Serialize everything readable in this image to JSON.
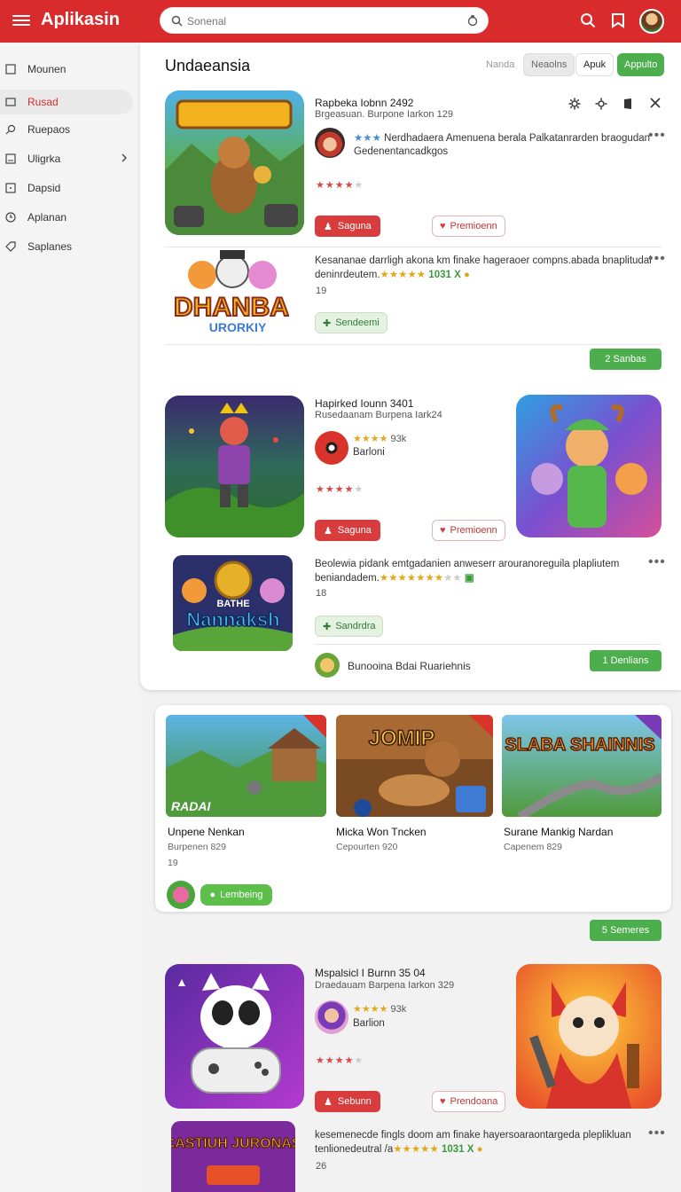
{
  "app": {
    "title": "Aplikasin"
  },
  "search": {
    "placeholder": "Sonenal"
  },
  "sidebar": {
    "items": [
      {
        "label": "Mounen",
        "icon": "page-icon"
      },
      {
        "label": "Rusad",
        "icon": "page-icon"
      },
      {
        "label": "Ruepaos",
        "icon": "search-icon"
      },
      {
        "label": "Uligrka",
        "icon": "page-icon"
      },
      {
        "label": "Dapsid",
        "icon": "page-icon"
      },
      {
        "label": "Aplanan",
        "icon": "clock-icon"
      },
      {
        "label": "Saplanes",
        "icon": "tag-icon"
      }
    ]
  },
  "section": {
    "title": "Undaeansia"
  },
  "filters": [
    "Nanda",
    "Neaolns",
    "Apuk",
    "Appulto"
  ],
  "row1": {
    "title": "Rapbeka  Iobnn  2492",
    "sub": "Brgeasuan.  Burpone  Iarkon  129",
    "desc_line1": "Nerdhadaera  Amenuena  berala  Palkatanrarden  braogudan",
    "desc_line2": "Gedenentancadkgos",
    "rating": 4,
    "primary_btn": "Saguna",
    "secondary_btn": "Premioenn"
  },
  "row2": {
    "logo_text": "DHANBA",
    "logo_sub": "URORKIY",
    "desc_line1": "Kesananae  darrligh akona  km  finake  hageraoer compns.abada  bnaplitudai",
    "desc_line2": "deninrdeutem.",
    "count": "1031 X",
    "sub": "19",
    "btn": "Sendeemi",
    "more": "2  Sanbas"
  },
  "row3": {
    "title": "Hapirked  Iounn  3401",
    "sub": "Rusedaanam  Burpena  Iark24",
    "count": "93k",
    "name": "Barloni",
    "rating": 4,
    "primary_btn": "Saguna",
    "secondary_btn": "Premioenn"
  },
  "row4": {
    "logo_text": "Nannaksh",
    "logo_pre": "BATHE",
    "desc_line1": "Beolewia  pidank  emtgadanien  anweserr  arouranoreguila  plapliutem",
    "desc_line2": "beniandadem.",
    "sub": "18",
    "btn": "Sandrdra",
    "footer": "Bunooina  Bdai  Ruariehnis",
    "more": "1  Denlians"
  },
  "cards": [
    {
      "banner": "RADAI",
      "title": "Unpene Nenkan",
      "sub": "Burpenen  829"
    },
    {
      "banner": "JOMIP",
      "title": "Micka Won Tncken",
      "sub": "Cepourten  920"
    },
    {
      "banner": "SLABA SHAINNIS",
      "title": "Surane Mankig Nardan",
      "sub": "Capenem  829"
    }
  ],
  "card_count": "19",
  "card_btn": "Lembeing",
  "more3": "5  Semeres",
  "row5": {
    "title": "Mspalsicl  I  Burnn  35 04",
    "sub": "Draedauam  Barpena  Iarkon  329",
    "count": "93k",
    "name": "Barlion",
    "rating": 4,
    "primary_btn": "Sebunn",
    "secondary_btn": "Prendoana"
  },
  "row6": {
    "logo_text": "SCASTIUH JURONASR",
    "desc_line1": "kesemenecde  fingls  doom  am  finake  hayersoaraontargeda  pleplikluan",
    "desc_line2": "tenlionedeutral /a",
    "count": "1031 X",
    "sub": "26"
  },
  "colors": {
    "brand": "#d92b2b",
    "green": "#4cae4c",
    "star": "#d94848"
  }
}
